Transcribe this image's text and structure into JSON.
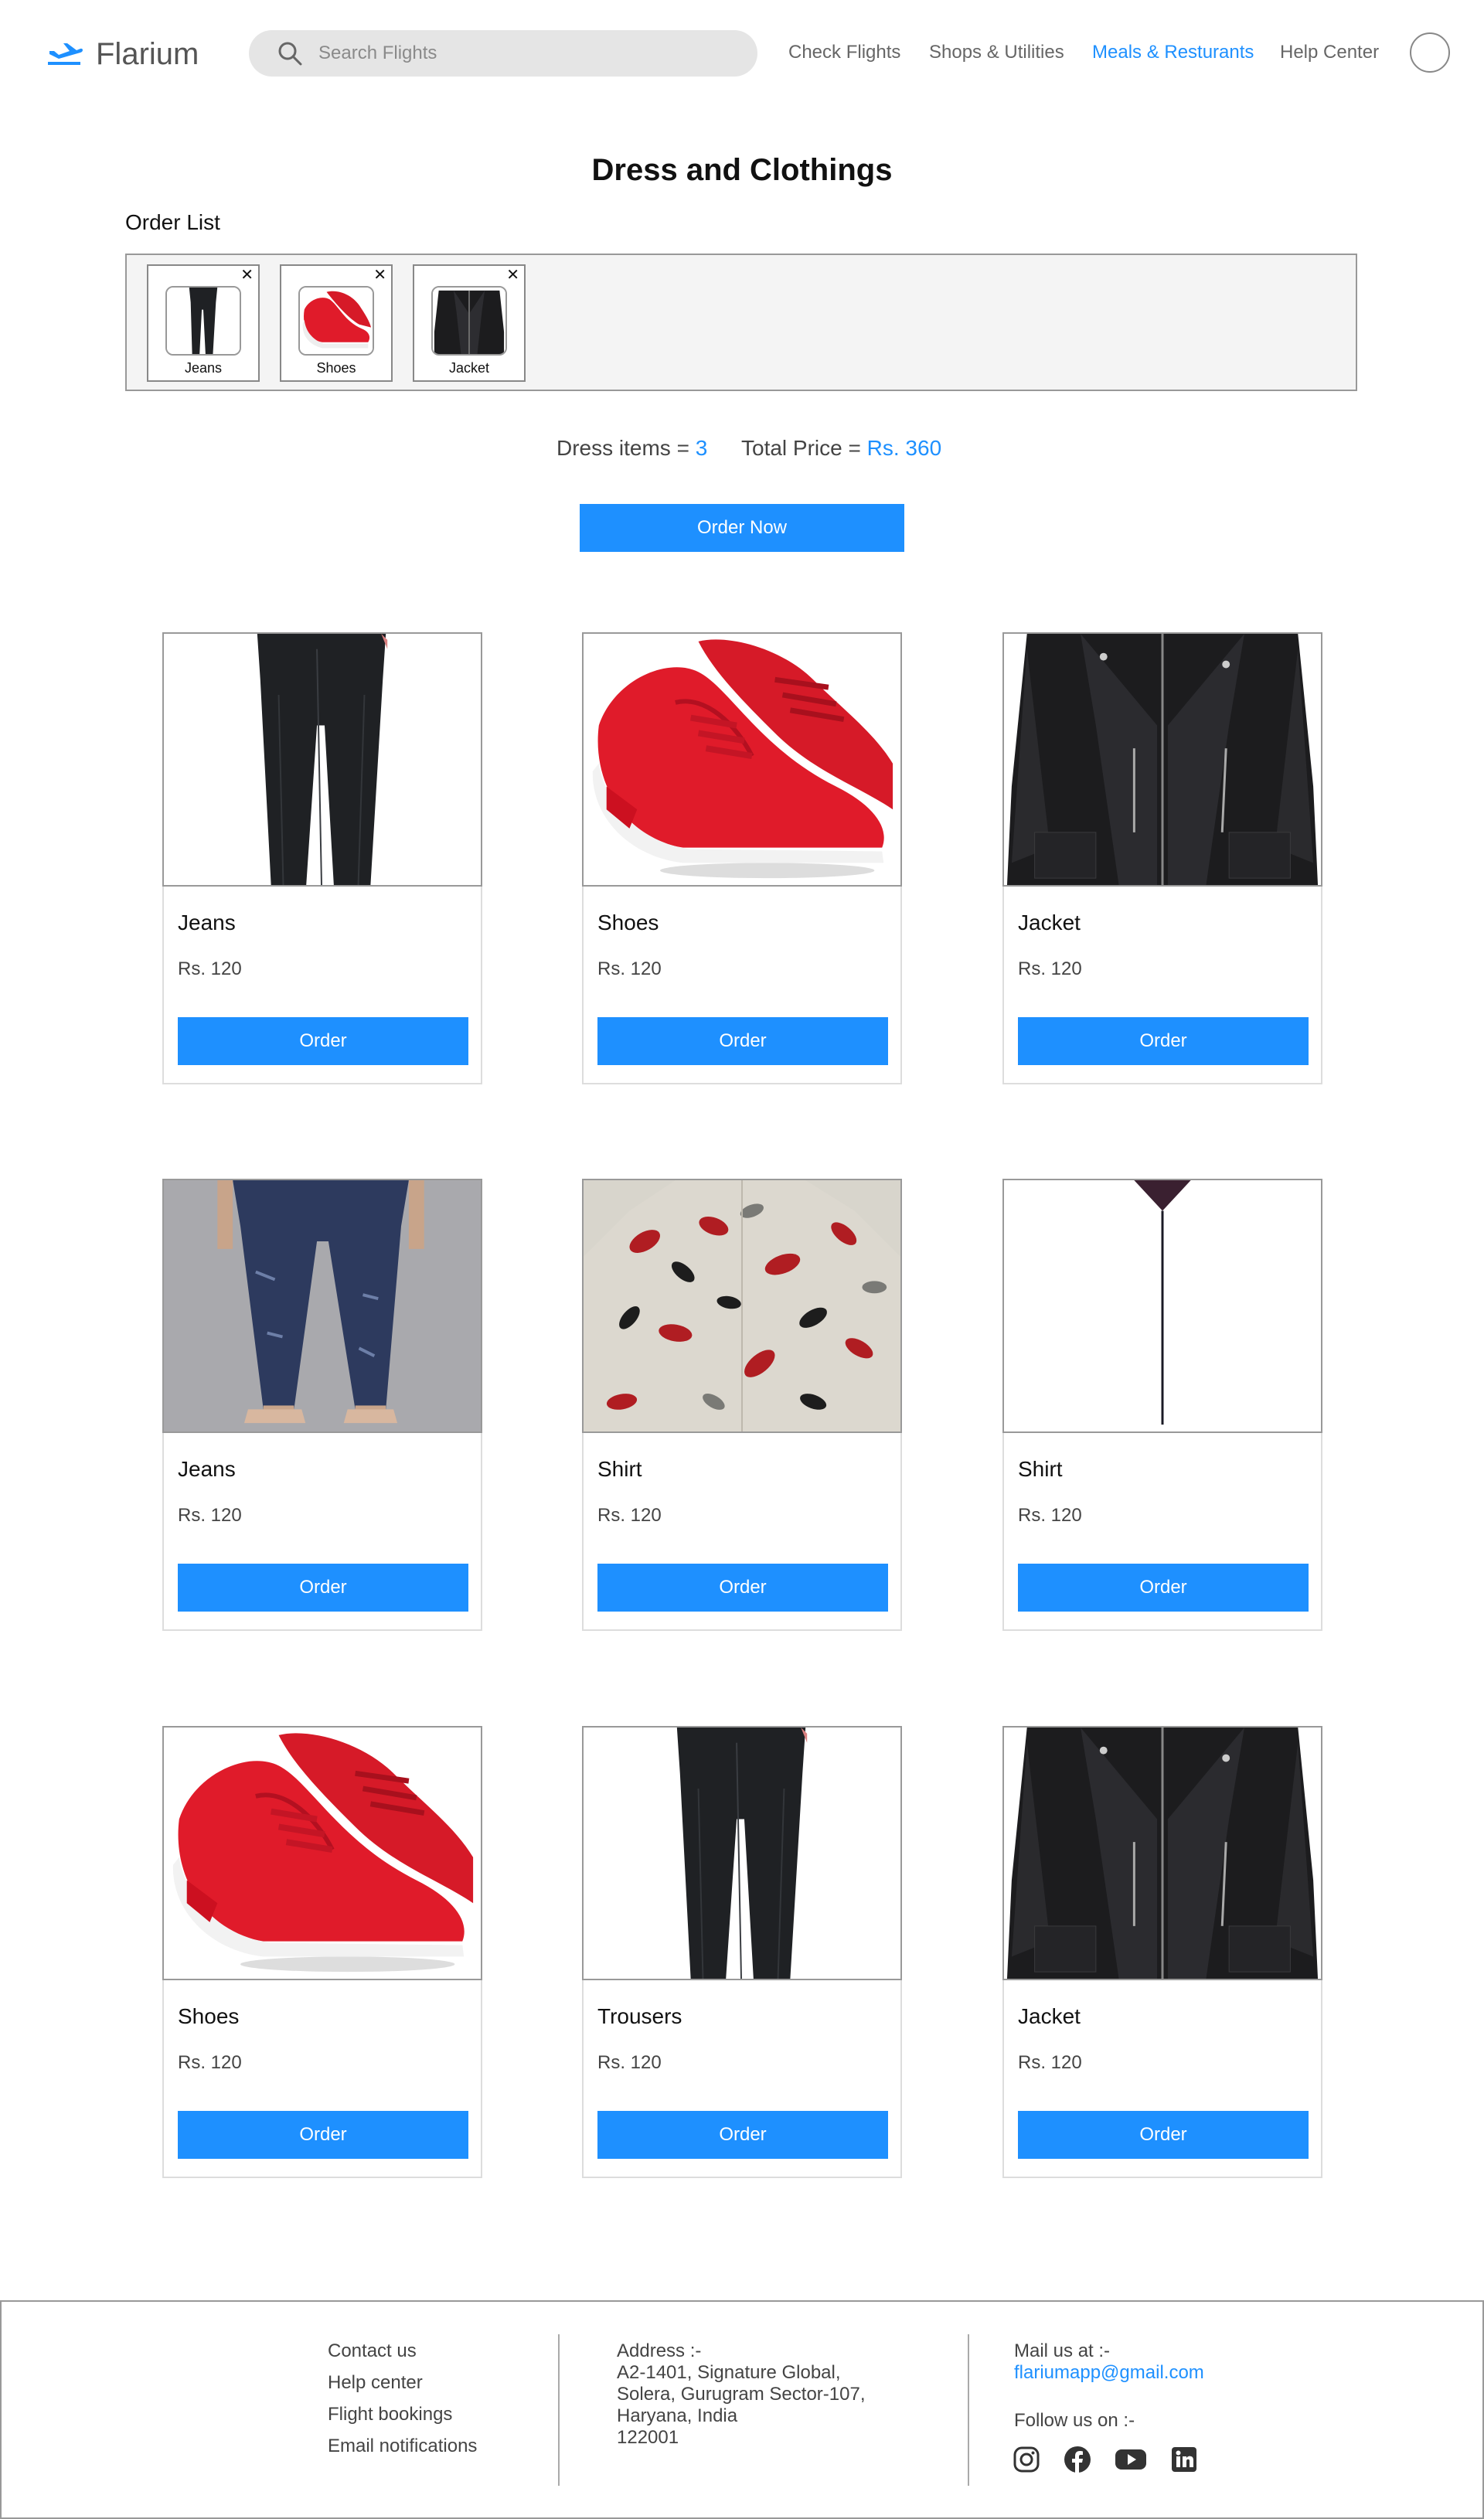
{
  "header": {
    "logo_text": "Flarium",
    "search_placeholder": "Search Flights",
    "nav": [
      {
        "label": "Check Flights",
        "active": false
      },
      {
        "label": "Shops & Utilities",
        "active": false
      },
      {
        "label": "Meals & Resturants",
        "active": true
      },
      {
        "label": "Help Center",
        "active": false
      }
    ]
  },
  "page": {
    "title": "Dress and Clothings",
    "order_list_label": "Order List"
  },
  "order_list": [
    {
      "label": "Jeans",
      "icon": "trousers-thumbnail"
    },
    {
      "label": "Shoes",
      "icon": "red-shoes-thumbnail"
    },
    {
      "label": "Jacket",
      "icon": "leather-jacket-thumbnail"
    }
  ],
  "summary": {
    "items_label": "Dress items = ",
    "items_value": "3",
    "total_label": "Total Price = ",
    "total_value": "Rs. 360"
  },
  "order_now_label": "Order Now",
  "products": [
    {
      "name": "Jeans",
      "price": "Rs. 120",
      "button": "Order",
      "image": "black-trousers"
    },
    {
      "name": "Shoes",
      "price": "Rs. 120",
      "button": "Order",
      "image": "red-sneakers"
    },
    {
      "name": "Jacket",
      "price": "Rs. 120",
      "button": "Order",
      "image": "leather-jacket"
    },
    {
      "name": "Jeans",
      "price": "Rs. 120",
      "button": "Order",
      "image": "blue-jeans"
    },
    {
      "name": "Shirt",
      "price": "Rs. 120",
      "button": "Order",
      "image": "floral-shirt"
    },
    {
      "name": "Shirt",
      "price": "Rs. 120",
      "button": "Order",
      "image": "plaid-shirt"
    },
    {
      "name": "Shoes",
      "price": "Rs. 120",
      "button": "Order",
      "image": "red-sneakers"
    },
    {
      "name": "Trousers",
      "price": "Rs. 120",
      "button": "Order",
      "image": "black-trousers"
    },
    {
      "name": "Jacket",
      "price": "Rs. 120",
      "button": "Order",
      "image": "leather-jacket"
    }
  ],
  "footer": {
    "links": [
      "Contact us",
      "Help center",
      "Flight bookings",
      "Email notifications"
    ],
    "address_lines": [
      "Address :-",
      "A2-1401, Signature Global,",
      "Solera, Gurugram Sector-107,",
      "Haryana, India",
      "122001"
    ],
    "mail_label": "Mail us at :-",
    "email": "flariumapp@gmail.com",
    "follow_label": "Follow us on :-",
    "socials": [
      "instagram-icon",
      "facebook-icon",
      "youtube-icon",
      "linkedin-icon"
    ]
  },
  "colors": {
    "accent": "#1e90ff",
    "search_bg": "#e5e5e5",
    "order_box_bg": "#f4f4f4"
  }
}
